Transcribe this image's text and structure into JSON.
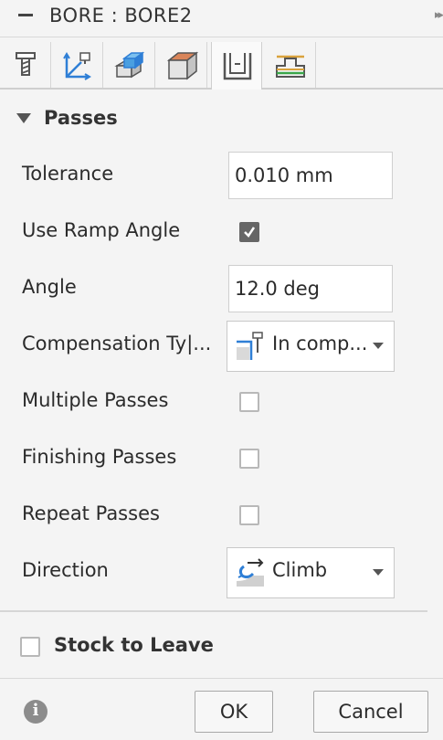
{
  "header": {
    "title": "BORE : BORE2",
    "collapse_icon": "minus-icon",
    "expand_icon": "double-chevron-right-icon"
  },
  "tabs": [
    {
      "icon": "tool-icon",
      "active": false
    },
    {
      "icon": "geometry-axes-icon",
      "active": false
    },
    {
      "icon": "heights-box-icon",
      "active": false
    },
    {
      "icon": "stock-box-icon",
      "active": false
    },
    {
      "icon": "passes-icon",
      "active": true
    },
    {
      "icon": "linking-icon",
      "active": false
    }
  ],
  "passes": {
    "section_title": "Passes",
    "tolerance_label": "Tolerance",
    "tolerance_value": "0.010 mm",
    "use_ramp_angle_label": "Use Ramp Angle",
    "use_ramp_angle_checked": true,
    "angle_label": "Angle",
    "angle_value": "12.0 deg",
    "compensation_type_label": "Compensation Ty|...",
    "compensation_type_value": "In comp...",
    "multiple_passes_label": "Multiple Passes",
    "multiple_passes_checked": false,
    "finishing_passes_label": "Finishing Passes",
    "finishing_passes_checked": false,
    "repeat_passes_label": "Repeat Passes",
    "repeat_passes_checked": false,
    "direction_label": "Direction",
    "direction_value": "Climb"
  },
  "stock_to_leave": {
    "label": "Stock to Leave",
    "checked": false
  },
  "footer": {
    "info_icon": "info-icon",
    "info_glyph": "i",
    "ok_label": "OK",
    "cancel_label": "Cancel"
  },
  "colors": {
    "accent_blue": "#2f7fd6",
    "panel_bg": "#f4f4f4",
    "stock_orange": "#d9855a"
  }
}
